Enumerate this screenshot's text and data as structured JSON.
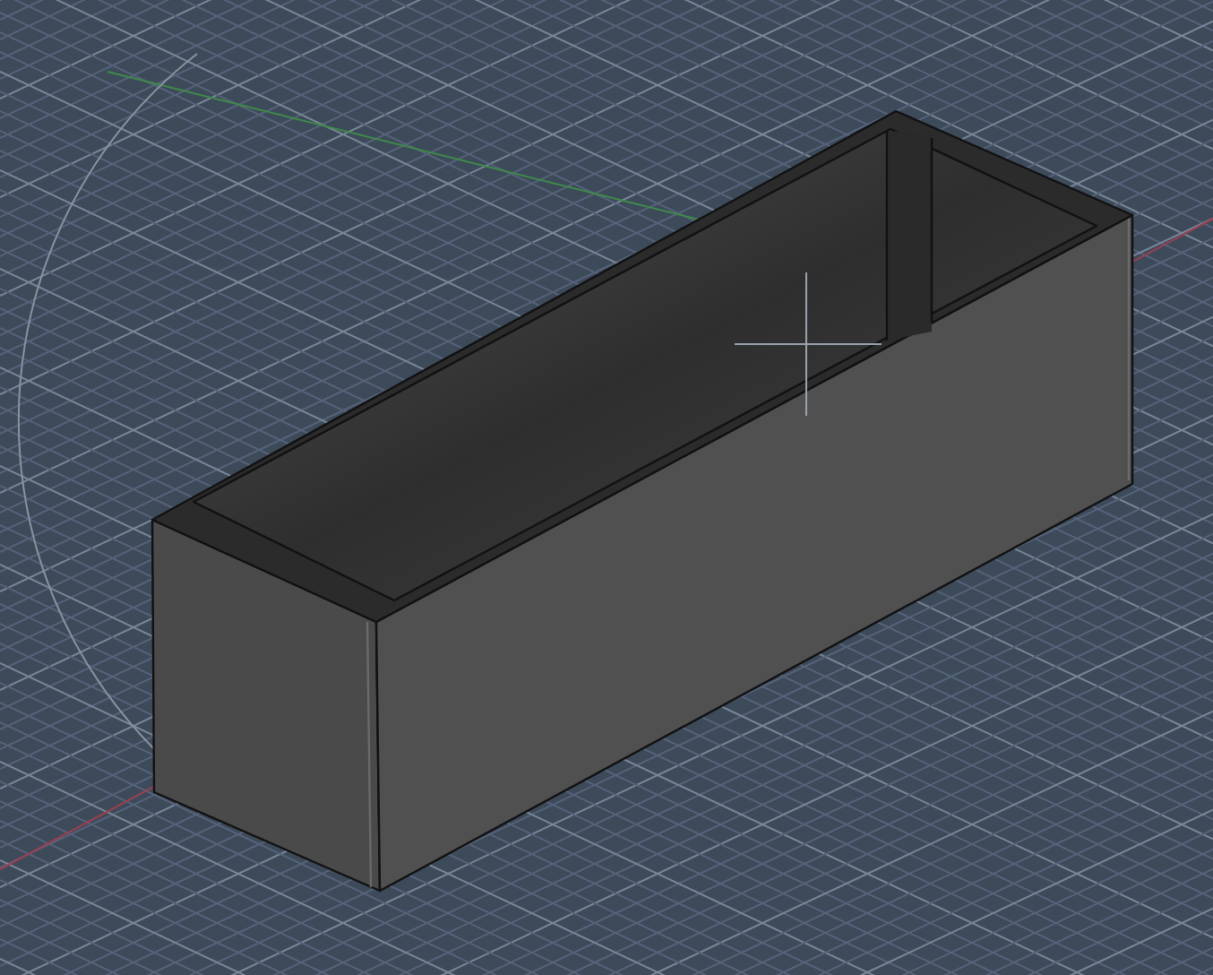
{
  "viewport": {
    "kind": "isometric-view"
  }
}
